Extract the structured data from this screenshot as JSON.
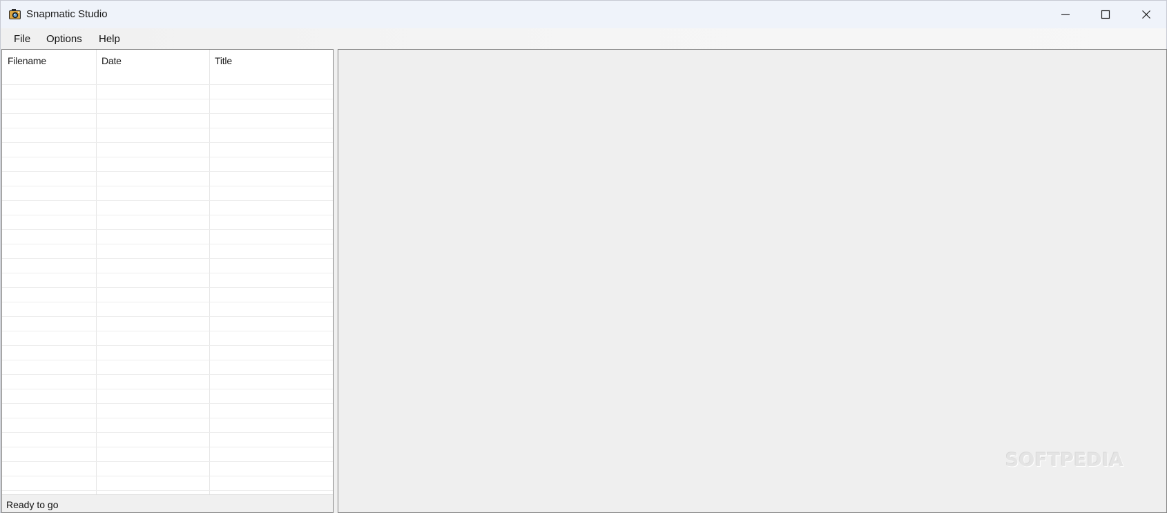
{
  "window": {
    "title": "Snapmatic Studio",
    "icon": "camera-icon",
    "controls": {
      "minimize": "minimize-icon",
      "maximize": "maximize-icon",
      "close": "close-icon"
    }
  },
  "menubar": {
    "items": [
      {
        "label": "File"
      },
      {
        "label": "Options"
      },
      {
        "label": "Help"
      }
    ]
  },
  "file_list": {
    "columns": [
      {
        "label": "Filename"
      },
      {
        "label": "Date"
      },
      {
        "label": "Title"
      }
    ],
    "rows": []
  },
  "statusbar": {
    "text": "Ready to go"
  },
  "watermark": {
    "text": "SOFTPEDIA"
  },
  "colors": {
    "titlebar_bg": "#eff3fa",
    "panel_bg": "#efefef",
    "list_bg": "#ffffff",
    "border": "#828282"
  }
}
